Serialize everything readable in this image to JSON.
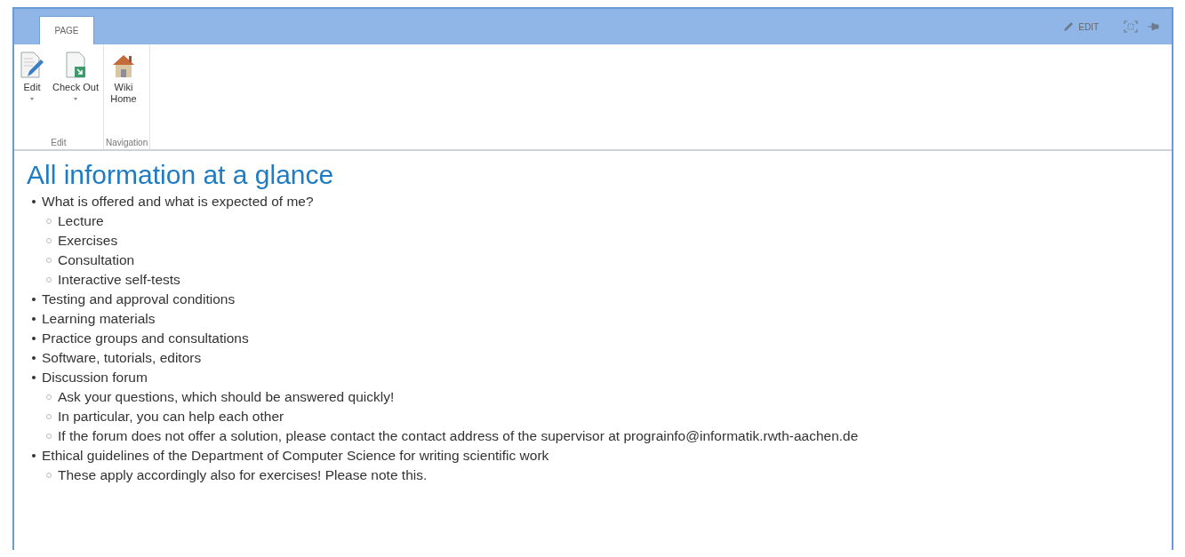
{
  "ribbon": {
    "tabs": [
      {
        "label": "PAGE",
        "selected": true
      }
    ],
    "actions": [
      {
        "label": "EDIT"
      }
    ],
    "groups": [
      {
        "label": "Edit",
        "buttons": [
          {
            "label": "Edit",
            "kind": "edit",
            "dropdown": true
          },
          {
            "label": "Check Out",
            "kind": "checkout",
            "dropdown": true
          }
        ]
      },
      {
        "label": "Navigation",
        "buttons": [
          {
            "label": "Wiki Home",
            "kind": "home",
            "dropdown": false
          }
        ]
      }
    ]
  },
  "content": {
    "heading": "All information at a glance",
    "items": [
      {
        "text": "What is offered and what is expected of me?",
        "children": [
          {
            "text": "Lecture"
          },
          {
            "text": "Exercises"
          },
          {
            "text": "Consultation"
          },
          {
            "text": "Interactive self-tests"
          }
        ]
      },
      {
        "text": "Testing and approval conditions"
      },
      {
        "text": "Learning materials"
      },
      {
        "text": "Practice groups and consultations"
      },
      {
        "text": "Software, tutorials, editors"
      },
      {
        "text": "Discussion forum",
        "children": [
          {
            "text": "Ask your questions, which should be answered quickly!"
          },
          {
            "text": "In particular, you can help each other"
          },
          {
            "text": "If the forum does not offer a solution, please contact the contact address of the supervisor at prograinfo@informatik.rwth-aachen.de"
          }
        ]
      },
      {
        "text": "Ethical guidelines of the Department of Computer Science for writing scientific work",
        "children": [
          {
            "text": "These apply accordingly also for exercises! Please note this."
          }
        ]
      }
    ]
  }
}
